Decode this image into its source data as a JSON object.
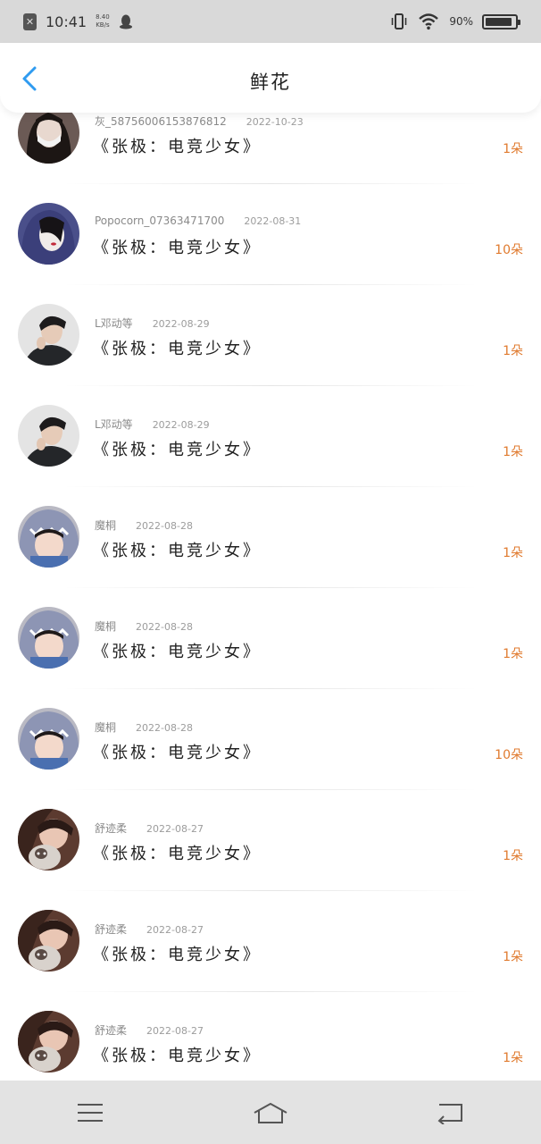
{
  "status_bar": {
    "time": "10:41",
    "speed_value": "8.40",
    "speed_unit": "KB/s",
    "battery_percent": "90%",
    "battery_level": 0.9
  },
  "header": {
    "title": "鲜花"
  },
  "items": [
    {
      "username": "灰_5875600615387681​2",
      "date": "2022-10-23",
      "book": "《张极：电竞少女》",
      "count": "1朵",
      "avatar": "girl-mask"
    },
    {
      "username": "Popocorn_07363471700",
      "date": "2022-08-31",
      "book": "《张极：电竞少女》",
      "count": "10朵",
      "avatar": "girl-hood"
    },
    {
      "username": "L邓动等",
      "date": "2022-08-29",
      "book": "《张极：电竞少女》",
      "count": "1朵",
      "avatar": "boy-dark"
    },
    {
      "username": "L邓动等",
      "date": "2022-08-29",
      "book": "《张极：电竞少女》",
      "count": "1朵",
      "avatar": "boy-dark"
    },
    {
      "username": "魔桐",
      "date": "2022-08-28",
      "book": "《张极：电竞少女》",
      "count": "1朵",
      "avatar": "shark-hood"
    },
    {
      "username": "魔桐",
      "date": "2022-08-28",
      "book": "《张极：电竞少女》",
      "count": "1朵",
      "avatar": "shark-hood"
    },
    {
      "username": "魔桐",
      "date": "2022-08-28",
      "book": "《张极：电竞少女》",
      "count": "10朵",
      "avatar": "shark-hood"
    },
    {
      "username": "舒迹柔",
      "date": "2022-08-27",
      "book": "《张极：电竞少女》",
      "count": "1朵",
      "avatar": "girl-cat"
    },
    {
      "username": "舒迹柔",
      "date": "2022-08-27",
      "book": "《张极：电竞少女》",
      "count": "1朵",
      "avatar": "girl-cat"
    },
    {
      "username": "舒迹柔",
      "date": "2022-08-27",
      "book": "《张极：电竞少女》",
      "count": "1朵",
      "avatar": "girl-cat"
    }
  ],
  "colors": {
    "accent_blue": "#2f9bf0",
    "count_orange": "#e07a2e"
  }
}
